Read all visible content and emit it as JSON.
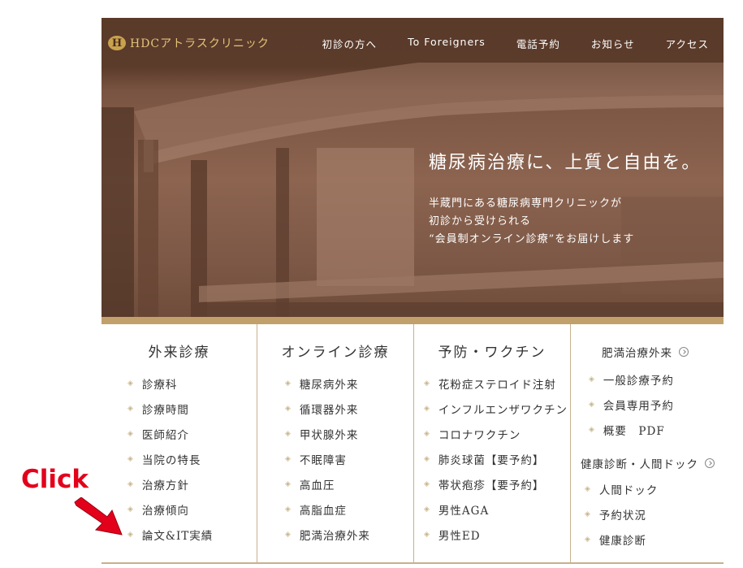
{
  "logo": {
    "mark": "H",
    "text": "HDCアトラスクリニック"
  },
  "nav": {
    "items": [
      "初診の方へ",
      "To Foreigners",
      "電話予約",
      "お知らせ",
      "アクセス"
    ]
  },
  "hero": {
    "title": "糖尿病治療に、上質と自由を。",
    "lines": [
      "半蔵門にある糖尿病専門クリニックが",
      "初診から受けられる",
      "“会員制オンライン診療”をお届けします"
    ]
  },
  "menu": {
    "outpatient": {
      "title": "外来診療",
      "items": [
        "診療科",
        "診療時間",
        "医師紹介",
        "当院の特長",
        "治療方針",
        "治療傾向",
        "論文&IT実績"
      ]
    },
    "online": {
      "title": "オンライン診療",
      "items": [
        "糖尿病外来",
        "循環器外来",
        "甲状腺外来",
        "不眠障害",
        "高血圧",
        "高脂血症",
        "肥満治療外来"
      ]
    },
    "prevention": {
      "title": "予防・ワクチン",
      "items": [
        "花粉症ステロイド注射",
        "インフルエンザワクチン",
        "コロナワクチン",
        "肺炎球菌【要予約】",
        "帯状疱疹【要予約】",
        "男性AGA",
        "男性ED"
      ]
    },
    "obesity": {
      "title": "肥満治療外来",
      "items": [
        "一般診療予約",
        "会員専用予約",
        "概要　PDF"
      ]
    },
    "checkup": {
      "title": "健康診断・人間ドック",
      "items": [
        "人間ドック",
        "予約状況",
        "健康診断"
      ]
    }
  },
  "annotation": {
    "label": "Click",
    "color": "#e3001b"
  },
  "colors": {
    "brown": "#5a3a29",
    "gold": "#c2a06b",
    "divider": "#c9b08c"
  }
}
